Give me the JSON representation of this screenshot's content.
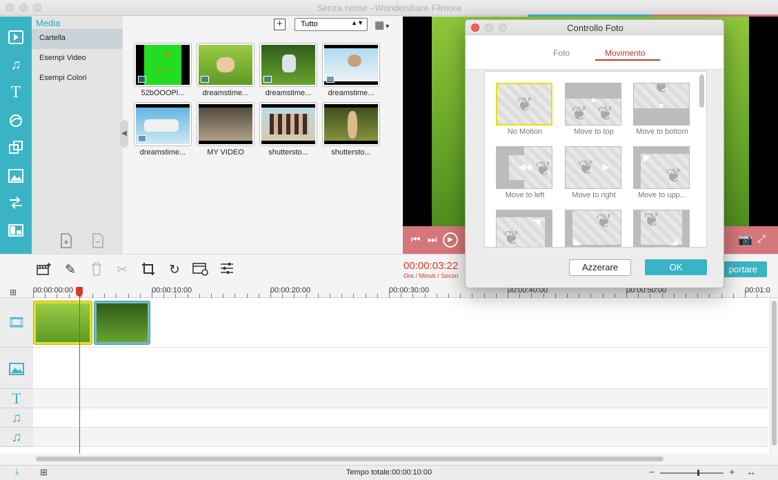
{
  "window": {
    "title": "Senza nome - Wondershare Filmora"
  },
  "colors": {
    "accent": "#3ab4c4",
    "timecode": "#d33a2c",
    "preview_bar": "#d4767a"
  },
  "sidebar": {
    "icons": [
      "media-icon",
      "music-icon",
      "text-icon",
      "filter-icon",
      "overlay-icon",
      "element-icon",
      "transition-icon",
      "split-screen-icon"
    ]
  },
  "media_panel": {
    "title": "Media",
    "folders": [
      {
        "label": "Cartella"
      },
      {
        "label": "Esempi Video"
      },
      {
        "label": "Esempi Colori"
      }
    ]
  },
  "library": {
    "add_label": "+",
    "filter_value": "Tutto",
    "items": [
      {
        "label": "52bOOOPl..."
      },
      {
        "label": "dreamstime..."
      },
      {
        "label": "dreamstime..."
      },
      {
        "label": "dreamstime..."
      },
      {
        "label": "dreamstime..."
      },
      {
        "label": "MY VIDEO"
      },
      {
        "label": "shuttersto..."
      },
      {
        "label": "shuttersto..."
      }
    ]
  },
  "toolbar": {
    "timecode": "00:00:03:22",
    "timecode_sub": "Ore / Minuti / Secon",
    "export_label": "portare"
  },
  "ruler": {
    "labels": [
      "00:00:00:00",
      "00:00:10:00",
      "00:00:20:00",
      "00:00:30:00",
      "00:00:40:00",
      "00:00:50:00",
      "00:01:0"
    ]
  },
  "status": {
    "total": "Tempo totale:00:00:10:00"
  },
  "dialog": {
    "title": "Controllo Foto",
    "tabs": [
      {
        "label": "Foto"
      },
      {
        "label": "Movimento"
      }
    ],
    "active_tab": "Movimento",
    "motions": [
      {
        "label": "No Motion"
      },
      {
        "label": "Move to top"
      },
      {
        "label": "Move to bottom"
      },
      {
        "label": "Move to left"
      },
      {
        "label": "Move to right"
      },
      {
        "label": "Move to upp..."
      },
      {
        "label": ""
      },
      {
        "label": ""
      },
      {
        "label": ""
      }
    ],
    "reset_label": "Azzerare",
    "ok_label": "OK"
  }
}
